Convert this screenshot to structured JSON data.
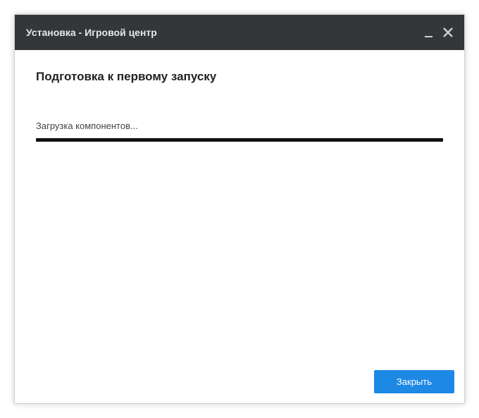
{
  "titlebar": {
    "title": "Установка - Игровой центр"
  },
  "main": {
    "heading": "Подготовка к первому запуску",
    "status": "Загрузка компонентов...",
    "progress_percent": 100
  },
  "footer": {
    "close_label": "Закрыть"
  },
  "colors": {
    "titlebar_bg": "#33373a",
    "primary_button": "#1e88e5"
  }
}
